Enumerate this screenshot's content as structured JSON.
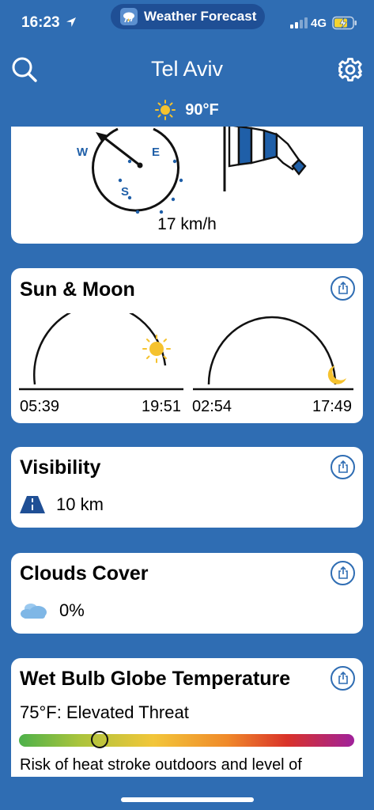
{
  "status_bar": {
    "time": "16:23",
    "app_name": "Weather Forecast",
    "network": "4G"
  },
  "header": {
    "city": "Tel Aviv",
    "temperature": "90°F",
    "weather_icon": "sun-icon"
  },
  "wind": {
    "compass_labels": {
      "west": "W",
      "east": "E",
      "south": "S"
    },
    "speed": "17 km/h"
  },
  "sun_moon": {
    "title": "Sun & Moon",
    "sunrise": "05:39",
    "sunset": "19:51",
    "moonrise": "02:54",
    "moonset": "17:49"
  },
  "visibility": {
    "title": "Visibility",
    "value": "10 km"
  },
  "clouds": {
    "title": "Clouds Cover",
    "value": "0%"
  },
  "wbgt": {
    "title": "Wet Bulb Globe Temperature",
    "status": "75°F: Elevated Threat",
    "level_percent": 24,
    "description": "Risk of heat stroke outdoors and level of"
  },
  "colors": {
    "background": "#2f6db3",
    "accent": "#1f5fa8",
    "sun": "#f5c22e"
  }
}
